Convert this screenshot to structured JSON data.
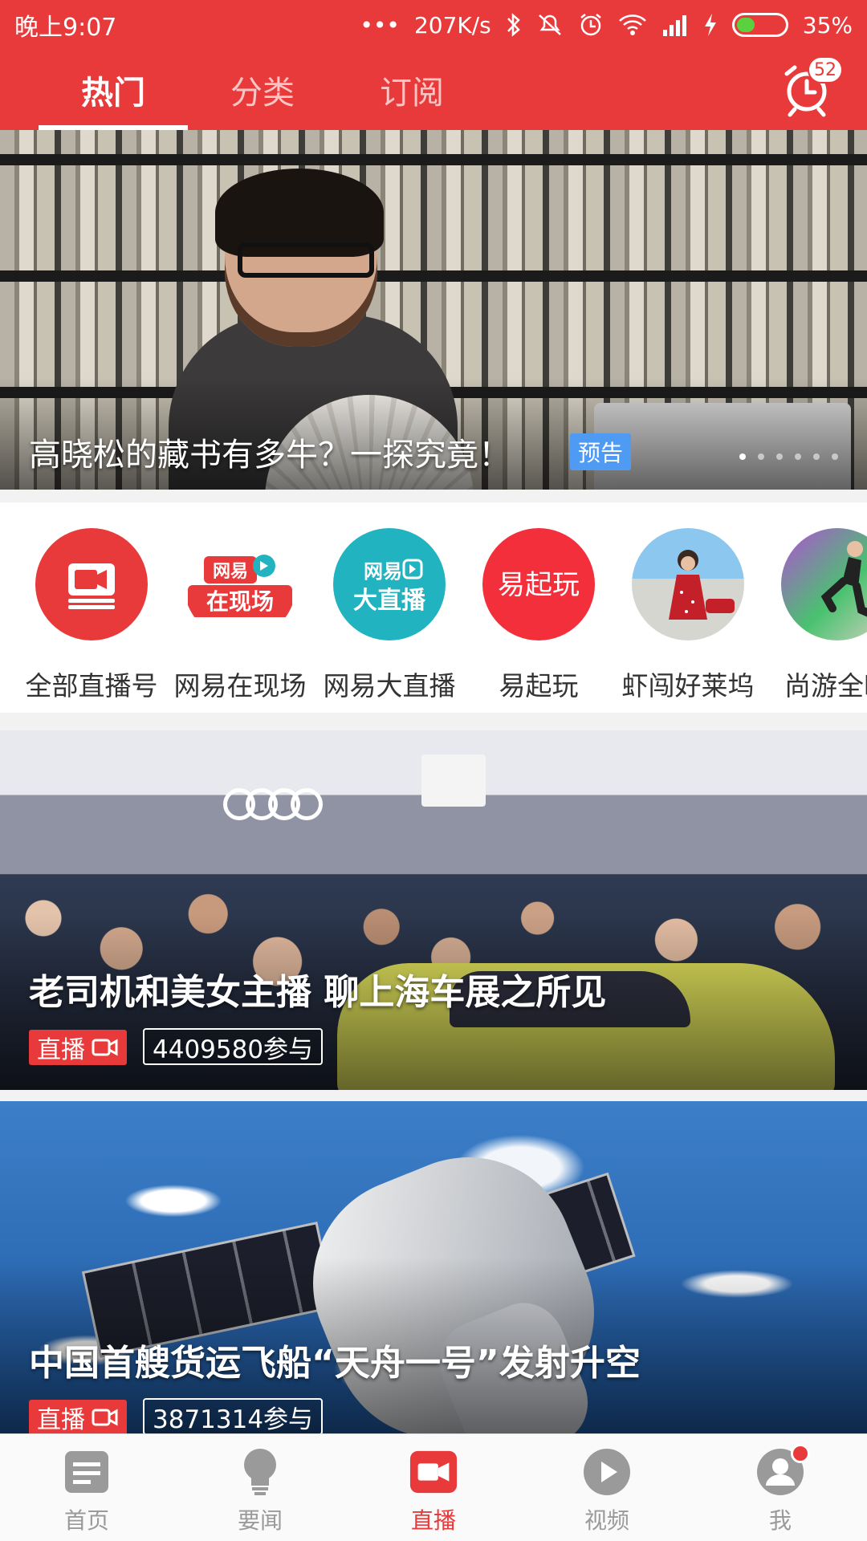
{
  "status": {
    "time": "晚上9:07",
    "dots": "•••",
    "speed": "207K/s",
    "battery": "35%"
  },
  "header": {
    "tabs": [
      {
        "label": "热门",
        "active": true
      },
      {
        "label": "分类",
        "active": false
      },
      {
        "label": "订阅",
        "active": false
      }
    ],
    "alarm_badge": "52"
  },
  "banner": {
    "title": "高晓松的藏书有多牛？一探究竟！",
    "tag": "预告",
    "page_count": 6,
    "active_page": 1
  },
  "channels": [
    {
      "label": "全部直播号",
      "icon": "video-camera-icon"
    },
    {
      "label": "网易在现场",
      "icon_text": "网易 在现场",
      "icon": "wangyi-zaixianchang-logo"
    },
    {
      "label": "网易大直播",
      "icon_text": "网易 大直播",
      "icon": "wangyi-dazhibo-logo"
    },
    {
      "label": "易起玩",
      "icon_text": "易起玩",
      "icon": "yiqiwan-logo"
    },
    {
      "label": "虾闯好莱坞",
      "icon": "avatar-woman-red-dress"
    },
    {
      "label": "尚游全时",
      "icon": "avatar-jumping-man"
    }
  ],
  "cards": [
    {
      "title": "老司机和美女主播 聊上海车展之所见",
      "live_label": "直播",
      "participants": "4409580参与"
    },
    {
      "title": "中国首艘货运飞船“天舟一号”发射升空",
      "live_label": "直播",
      "participants": "3871314参与"
    }
  ],
  "bottom_nav": [
    {
      "label": "首页",
      "icon": "document-icon",
      "active": false
    },
    {
      "label": "要闻",
      "icon": "lightbulb-icon",
      "active": false
    },
    {
      "label": "直播",
      "icon": "live-video-icon",
      "active": true
    },
    {
      "label": "视频",
      "icon": "play-icon",
      "active": false
    },
    {
      "label": "我",
      "icon": "user-icon",
      "active": false,
      "has_dot": true
    }
  ],
  "colors": {
    "brand_red": "#e83a3a",
    "tag_blue": "#4f9bf4",
    "teal": "#21b3c0"
  }
}
